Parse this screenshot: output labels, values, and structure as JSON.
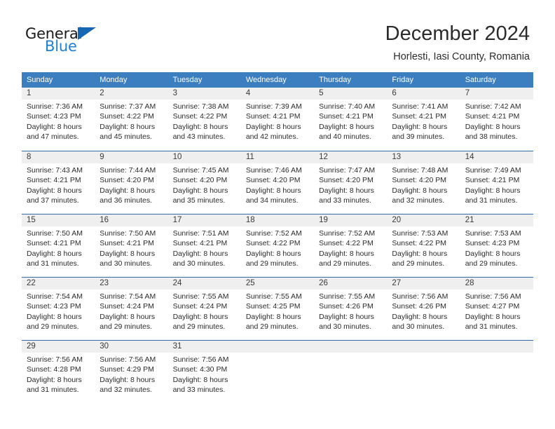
{
  "brand": {
    "name_part1": "General",
    "name_part2": "Blue",
    "triangle_icon": "triangle-icon",
    "accent_color": "#1f7fd0"
  },
  "header": {
    "title": "December 2024",
    "subtitle": "Horlesti, Iasi County, Romania"
  },
  "colors": {
    "header_bar": "#3c7fc1",
    "row_divider": "#2f6ca8",
    "daynum_band": "#efefef",
    "text": "#2b2b2b"
  },
  "calendar": {
    "weekdays": [
      "Sunday",
      "Monday",
      "Tuesday",
      "Wednesday",
      "Thursday",
      "Friday",
      "Saturday"
    ],
    "weeks": [
      {
        "days": [
          {
            "num": "1",
            "sunrise": "Sunrise: 7:36 AM",
            "sunset": "Sunset: 4:23 PM",
            "daylight1": "Daylight: 8 hours",
            "daylight2": "and 47 minutes."
          },
          {
            "num": "2",
            "sunrise": "Sunrise: 7:37 AM",
            "sunset": "Sunset: 4:22 PM",
            "daylight1": "Daylight: 8 hours",
            "daylight2": "and 45 minutes."
          },
          {
            "num": "3",
            "sunrise": "Sunrise: 7:38 AM",
            "sunset": "Sunset: 4:22 PM",
            "daylight1": "Daylight: 8 hours",
            "daylight2": "and 43 minutes."
          },
          {
            "num": "4",
            "sunrise": "Sunrise: 7:39 AM",
            "sunset": "Sunset: 4:21 PM",
            "daylight1": "Daylight: 8 hours",
            "daylight2": "and 42 minutes."
          },
          {
            "num": "5",
            "sunrise": "Sunrise: 7:40 AM",
            "sunset": "Sunset: 4:21 PM",
            "daylight1": "Daylight: 8 hours",
            "daylight2": "and 40 minutes."
          },
          {
            "num": "6",
            "sunrise": "Sunrise: 7:41 AM",
            "sunset": "Sunset: 4:21 PM",
            "daylight1": "Daylight: 8 hours",
            "daylight2": "and 39 minutes."
          },
          {
            "num": "7",
            "sunrise": "Sunrise: 7:42 AM",
            "sunset": "Sunset: 4:21 PM",
            "daylight1": "Daylight: 8 hours",
            "daylight2": "and 38 minutes."
          }
        ]
      },
      {
        "days": [
          {
            "num": "8",
            "sunrise": "Sunrise: 7:43 AM",
            "sunset": "Sunset: 4:21 PM",
            "daylight1": "Daylight: 8 hours",
            "daylight2": "and 37 minutes."
          },
          {
            "num": "9",
            "sunrise": "Sunrise: 7:44 AM",
            "sunset": "Sunset: 4:20 PM",
            "daylight1": "Daylight: 8 hours",
            "daylight2": "and 36 minutes."
          },
          {
            "num": "10",
            "sunrise": "Sunrise: 7:45 AM",
            "sunset": "Sunset: 4:20 PM",
            "daylight1": "Daylight: 8 hours",
            "daylight2": "and 35 minutes."
          },
          {
            "num": "11",
            "sunrise": "Sunrise: 7:46 AM",
            "sunset": "Sunset: 4:20 PM",
            "daylight1": "Daylight: 8 hours",
            "daylight2": "and 34 minutes."
          },
          {
            "num": "12",
            "sunrise": "Sunrise: 7:47 AM",
            "sunset": "Sunset: 4:20 PM",
            "daylight1": "Daylight: 8 hours",
            "daylight2": "and 33 minutes."
          },
          {
            "num": "13",
            "sunrise": "Sunrise: 7:48 AM",
            "sunset": "Sunset: 4:20 PM",
            "daylight1": "Daylight: 8 hours",
            "daylight2": "and 32 minutes."
          },
          {
            "num": "14",
            "sunrise": "Sunrise: 7:49 AM",
            "sunset": "Sunset: 4:21 PM",
            "daylight1": "Daylight: 8 hours",
            "daylight2": "and 31 minutes."
          }
        ]
      },
      {
        "days": [
          {
            "num": "15",
            "sunrise": "Sunrise: 7:50 AM",
            "sunset": "Sunset: 4:21 PM",
            "daylight1": "Daylight: 8 hours",
            "daylight2": "and 31 minutes."
          },
          {
            "num": "16",
            "sunrise": "Sunrise: 7:50 AM",
            "sunset": "Sunset: 4:21 PM",
            "daylight1": "Daylight: 8 hours",
            "daylight2": "and 30 minutes."
          },
          {
            "num": "17",
            "sunrise": "Sunrise: 7:51 AM",
            "sunset": "Sunset: 4:21 PM",
            "daylight1": "Daylight: 8 hours",
            "daylight2": "and 30 minutes."
          },
          {
            "num": "18",
            "sunrise": "Sunrise: 7:52 AM",
            "sunset": "Sunset: 4:22 PM",
            "daylight1": "Daylight: 8 hours",
            "daylight2": "and 29 minutes."
          },
          {
            "num": "19",
            "sunrise": "Sunrise: 7:52 AM",
            "sunset": "Sunset: 4:22 PM",
            "daylight1": "Daylight: 8 hours",
            "daylight2": "and 29 minutes."
          },
          {
            "num": "20",
            "sunrise": "Sunrise: 7:53 AM",
            "sunset": "Sunset: 4:22 PM",
            "daylight1": "Daylight: 8 hours",
            "daylight2": "and 29 minutes."
          },
          {
            "num": "21",
            "sunrise": "Sunrise: 7:53 AM",
            "sunset": "Sunset: 4:23 PM",
            "daylight1": "Daylight: 8 hours",
            "daylight2": "and 29 minutes."
          }
        ]
      },
      {
        "days": [
          {
            "num": "22",
            "sunrise": "Sunrise: 7:54 AM",
            "sunset": "Sunset: 4:23 PM",
            "daylight1": "Daylight: 8 hours",
            "daylight2": "and 29 minutes."
          },
          {
            "num": "23",
            "sunrise": "Sunrise: 7:54 AM",
            "sunset": "Sunset: 4:24 PM",
            "daylight1": "Daylight: 8 hours",
            "daylight2": "and 29 minutes."
          },
          {
            "num": "24",
            "sunrise": "Sunrise: 7:55 AM",
            "sunset": "Sunset: 4:24 PM",
            "daylight1": "Daylight: 8 hours",
            "daylight2": "and 29 minutes."
          },
          {
            "num": "25",
            "sunrise": "Sunrise: 7:55 AM",
            "sunset": "Sunset: 4:25 PM",
            "daylight1": "Daylight: 8 hours",
            "daylight2": "and 29 minutes."
          },
          {
            "num": "26",
            "sunrise": "Sunrise: 7:55 AM",
            "sunset": "Sunset: 4:26 PM",
            "daylight1": "Daylight: 8 hours",
            "daylight2": "and 30 minutes."
          },
          {
            "num": "27",
            "sunrise": "Sunrise: 7:56 AM",
            "sunset": "Sunset: 4:26 PM",
            "daylight1": "Daylight: 8 hours",
            "daylight2": "and 30 minutes."
          },
          {
            "num": "28",
            "sunrise": "Sunrise: 7:56 AM",
            "sunset": "Sunset: 4:27 PM",
            "daylight1": "Daylight: 8 hours",
            "daylight2": "and 31 minutes."
          }
        ]
      },
      {
        "days": [
          {
            "num": "29",
            "sunrise": "Sunrise: 7:56 AM",
            "sunset": "Sunset: 4:28 PM",
            "daylight1": "Daylight: 8 hours",
            "daylight2": "and 31 minutes."
          },
          {
            "num": "30",
            "sunrise": "Sunrise: 7:56 AM",
            "sunset": "Sunset: 4:29 PM",
            "daylight1": "Daylight: 8 hours",
            "daylight2": "and 32 minutes."
          },
          {
            "num": "31",
            "sunrise": "Sunrise: 7:56 AM",
            "sunset": "Sunset: 4:30 PM",
            "daylight1": "Daylight: 8 hours",
            "daylight2": "and 33 minutes."
          },
          {
            "num": "",
            "sunrise": "",
            "sunset": "",
            "daylight1": "",
            "daylight2": ""
          },
          {
            "num": "",
            "sunrise": "",
            "sunset": "",
            "daylight1": "",
            "daylight2": ""
          },
          {
            "num": "",
            "sunrise": "",
            "sunset": "",
            "daylight1": "",
            "daylight2": ""
          },
          {
            "num": "",
            "sunrise": "",
            "sunset": "",
            "daylight1": "",
            "daylight2": ""
          }
        ]
      }
    ]
  }
}
